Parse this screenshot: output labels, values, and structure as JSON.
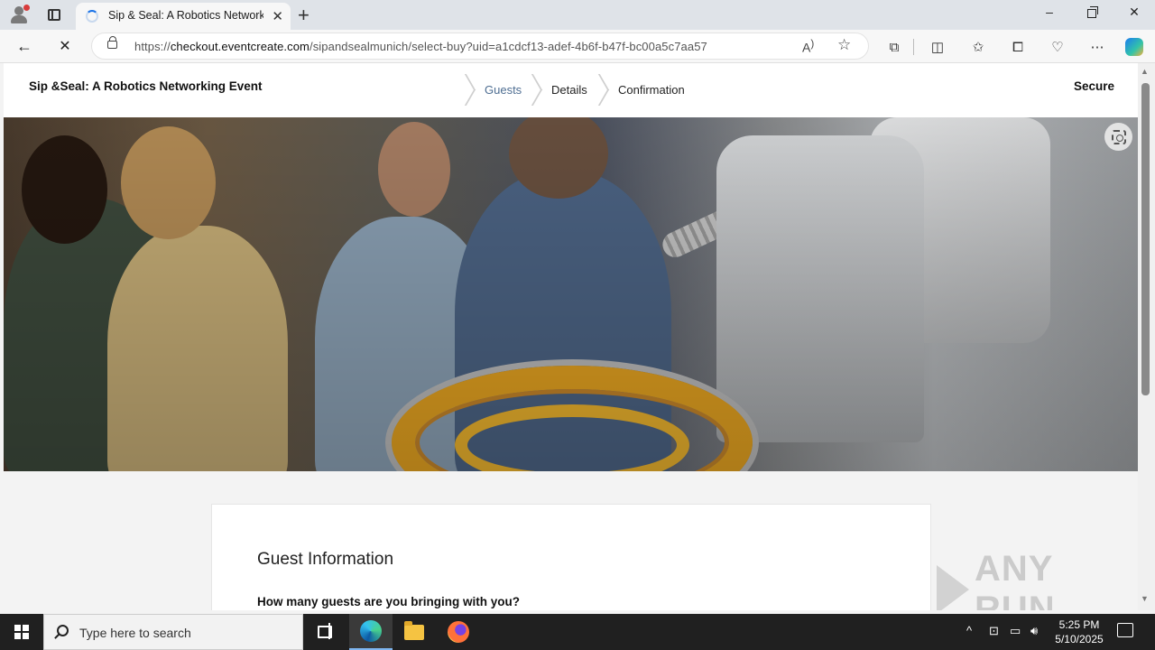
{
  "browser": {
    "tab_title": "Sip & Seal: A Robotics Networking Event",
    "url_prefix": "https://",
    "url_domain": "checkout.eventcreate.com",
    "url_path": "/sipandsealmunich/select-buy?uid=a1cdcf13-adef-4b6f-b47f-bc00a5c7aa57",
    "window_controls": {
      "minimize": "–",
      "close": "✕"
    }
  },
  "page": {
    "event_title": "Sip &Seal: A Robotics Networking Event",
    "breadcrumbs": [
      {
        "label": "Guests",
        "active": true
      },
      {
        "label": "Details",
        "active": false
      },
      {
        "label": "Confirmation",
        "active": false
      }
    ],
    "secure_label": "Secure",
    "card": {
      "title": "Guest Information",
      "question": "How many guests are you bringing with you?"
    }
  },
  "watermark": {
    "text": "ANY RUN"
  },
  "taskbar": {
    "search_placeholder": "Type here to search",
    "time": "5:25 PM",
    "date": "5/10/2025"
  },
  "colors": {
    "breadcrumb_active": "#4e6e92",
    "taskbar_bg": "#202020",
    "ring_gold": "#e8a521"
  }
}
